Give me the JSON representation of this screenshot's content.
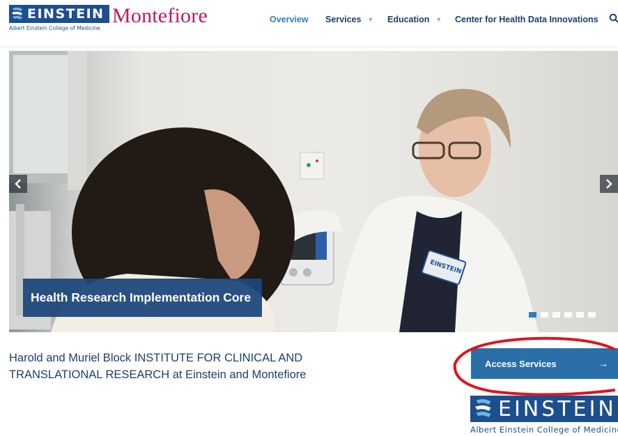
{
  "header": {
    "logo_einstein": {
      "name": "EINSTEIN",
      "tagline": "Albert Einstein College of Medicine"
    },
    "logo_montefiore": "Montefiore",
    "nav": [
      {
        "label": "Overview",
        "active": true,
        "dropdown": false
      },
      {
        "label": "Services",
        "active": false,
        "dropdown": true
      },
      {
        "label": "Education",
        "active": false,
        "dropdown": true
      },
      {
        "label": "Center for Health Data Innovations",
        "active": false,
        "dropdown": false
      }
    ],
    "search_icon": "search-icon"
  },
  "hero": {
    "caption": "Health Research Implementation Core",
    "badge_text": "EINSTEIN",
    "slide_count": 6,
    "active_slide": 1,
    "prev_icon": "chevron-left-icon",
    "next_icon": "chevron-right-icon"
  },
  "intro": {
    "line1": "Harold and Muriel Block INSTITUTE FOR CLINICAL AND",
    "line2": "TRANSLATIONAL RESEARCH at Einstein and Montefiore"
  },
  "cta": {
    "label": "Access Services",
    "icon": "arrow-right-icon"
  },
  "footer_logo": {
    "name": "EINSTEIN",
    "tagline": "Albert Einstein College of Medicine"
  },
  "colors": {
    "brand_blue": "#1d4f8f",
    "nav_text": "#1b3f6b",
    "nav_active": "#2f7fc0",
    "montefiore_magenta": "#c2185b",
    "button_blue": "#2a6fa8",
    "annotation_red": "#e0141e"
  }
}
